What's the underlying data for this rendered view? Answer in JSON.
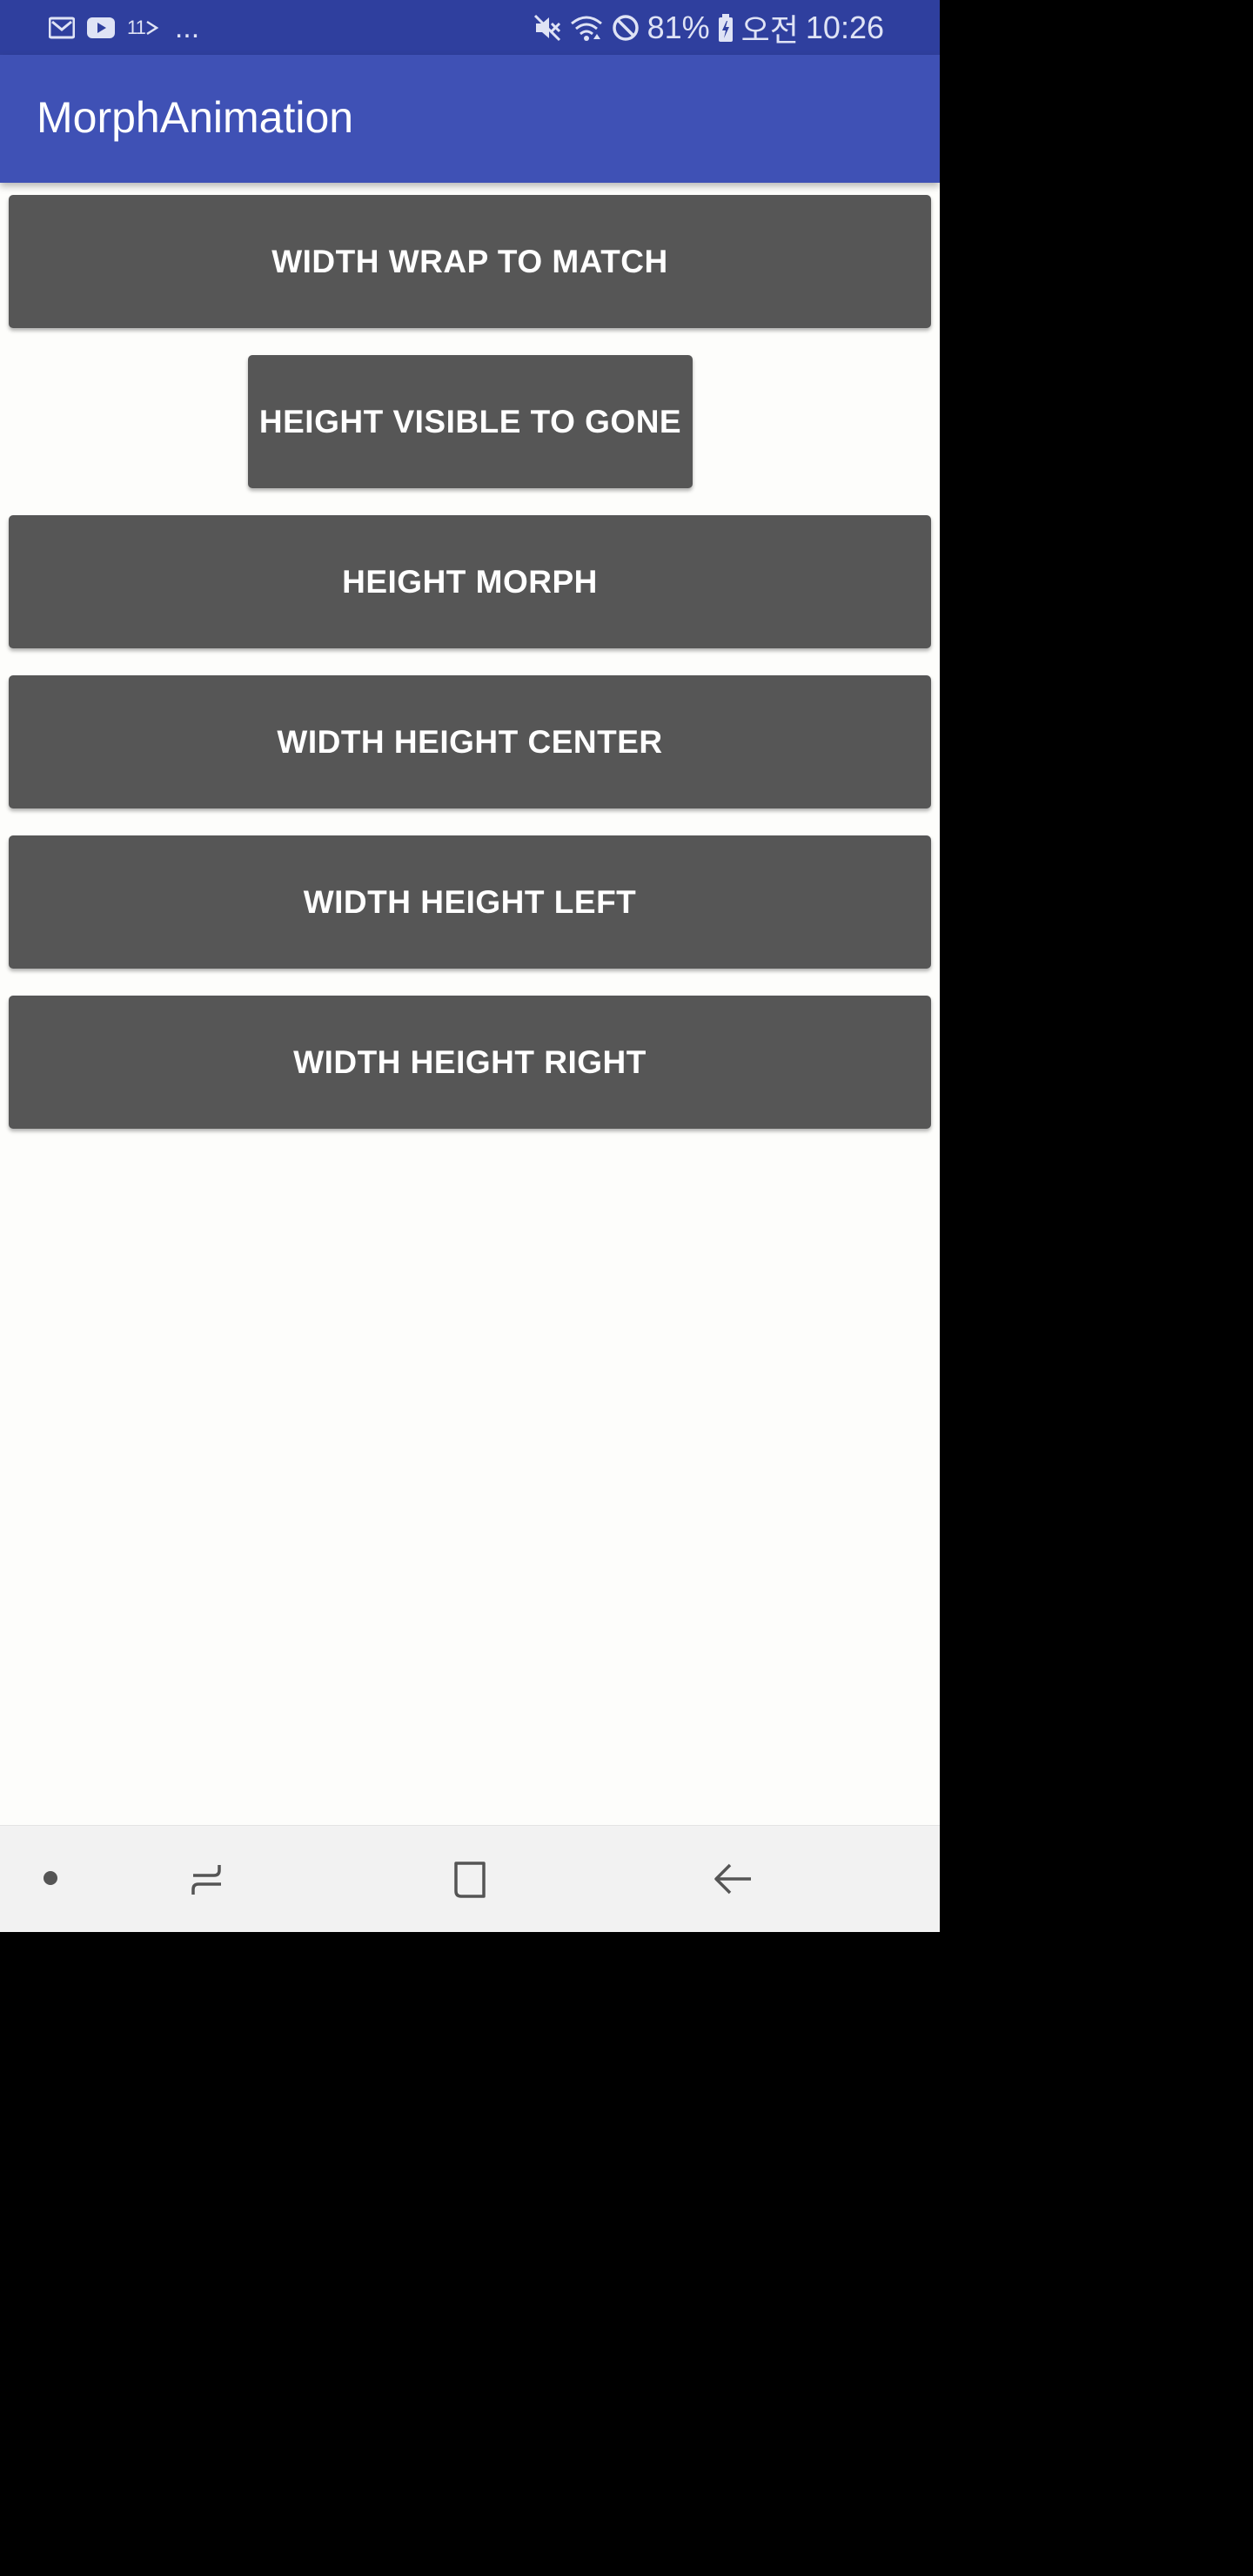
{
  "status_bar": {
    "left_icons": [
      "gmail-icon",
      "youtube-icon",
      "notification-icon"
    ],
    "notification_count": "11",
    "more": "...",
    "right_icons": [
      "mute-icon",
      "wifi-icon",
      "do-not-disturb-icon",
      "battery-icon"
    ],
    "battery_percent": "81%",
    "ampm": "오전",
    "time": "10:26"
  },
  "app_bar": {
    "title": "MorphAnimation"
  },
  "buttons": [
    "WIDTH WRAP TO MATCH",
    "HEIGHT VISIBLE TO GONE",
    "HEIGHT MORPH",
    "WIDTH HEIGHT CENTER",
    "WIDTH HEIGHT LEFT",
    "WIDTH HEIGHT RIGHT"
  ],
  "nav_bar": {
    "icons": [
      "nav-dot-icon",
      "recent-apps-icon",
      "home-icon",
      "back-icon"
    ]
  },
  "colors": {
    "status_bar": "#2f3f9e",
    "app_bar": "#3f51b5",
    "button": "#565656",
    "background": "#fdfdfb",
    "nav_bar": "#f2f2f2"
  }
}
